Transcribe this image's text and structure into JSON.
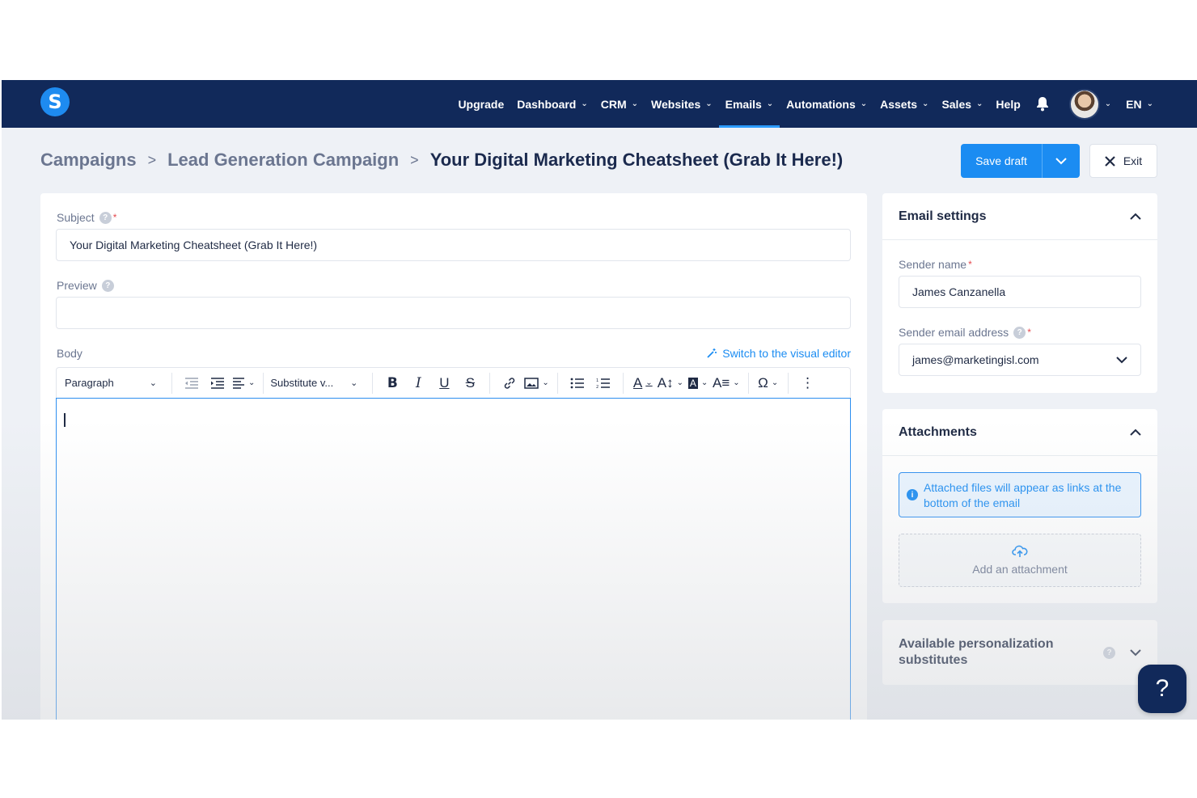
{
  "nav": {
    "logo": "S",
    "items": [
      {
        "label": "Upgrade",
        "has_menu": false,
        "active": false
      },
      {
        "label": "Dashboard",
        "has_menu": true,
        "active": false
      },
      {
        "label": "CRM",
        "has_menu": true,
        "active": false
      },
      {
        "label": "Websites",
        "has_menu": true,
        "active": false
      },
      {
        "label": "Emails",
        "has_menu": true,
        "active": true
      },
      {
        "label": "Automations",
        "has_menu": true,
        "active": false
      },
      {
        "label": "Assets",
        "has_menu": true,
        "active": false
      },
      {
        "label": "Sales",
        "has_menu": true,
        "active": false
      },
      {
        "label": "Help",
        "has_menu": false,
        "active": false
      }
    ],
    "language": "EN"
  },
  "breadcrumb": {
    "items": [
      "Campaigns",
      "Lead Generation Campaign"
    ],
    "current": "Your Digital Marketing Cheatsheet (Grab It Here!)"
  },
  "actions": {
    "save_draft": "Save draft",
    "exit": "Exit"
  },
  "form": {
    "subject_label": "Subject",
    "subject_value": "Your Digital Marketing Cheatsheet (Grab It Here!)",
    "preview_label": "Preview",
    "preview_value": "",
    "body_label": "Body",
    "switch_link": "Switch to the visual editor",
    "toolbar": {
      "paragraph": "Paragraph",
      "substitute": "Substitute v..."
    }
  },
  "email_settings": {
    "title": "Email settings",
    "sender_name_label": "Sender name",
    "sender_name_value": "James Canzanella",
    "sender_email_label": "Sender email address",
    "sender_email_value": "james@marketingisl.com"
  },
  "attachments": {
    "title": "Attachments",
    "info": "Attached files will appear as links at the bottom of the email",
    "add": "Add an attachment"
  },
  "personalization": {
    "title": "Available personalization substitutes"
  },
  "colors": {
    "nav_bg": "#11295a",
    "accent": "#1b8cf2",
    "page_bg": "#eef1f6"
  }
}
